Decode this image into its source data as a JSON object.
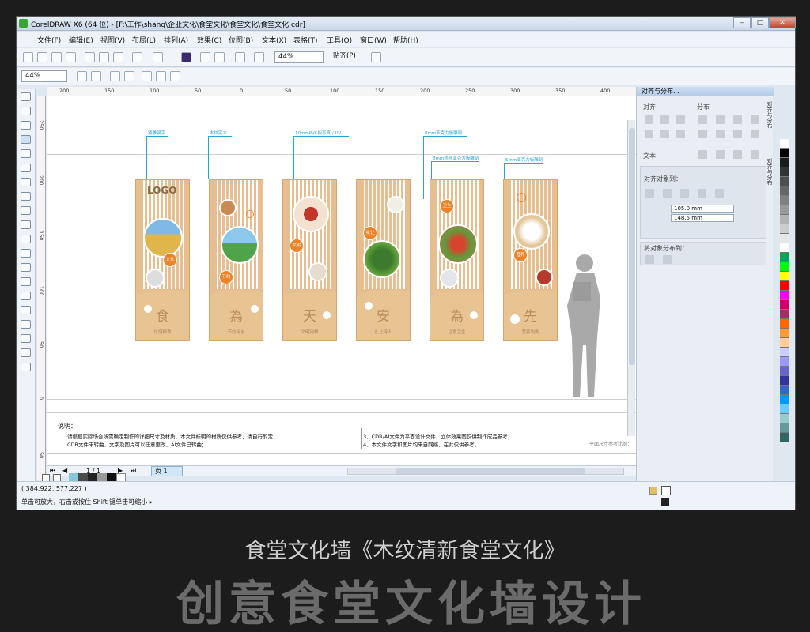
{
  "window": {
    "title": "CorelDRAW X6 (64 位) - [F:\\工作\\shang\\企业文化\\食堂文化\\食堂文化\\食堂文化.cdr]",
    "btn_min": "–",
    "btn_max": "□",
    "btn_close": "✕"
  },
  "menu": [
    "文件(F)",
    "编辑(E)",
    "视图(V)",
    "布局(L)",
    "排列(A)",
    "效果(C)",
    "位图(B)",
    "文本(X)",
    "表格(T)",
    "工具(O)",
    "窗口(W)",
    "帮助(H)"
  ],
  "toolbar": {
    "zoom": "44%",
    "snap": "贴齐(P)"
  },
  "propbar": {
    "zoom": "44%"
  },
  "ruler": {
    "h": [
      "200",
      "150",
      "100",
      "50",
      "0",
      "50",
      "100",
      "150",
      "200",
      "250",
      "300",
      "350",
      "400",
      "450"
    ],
    "v": [
      "250",
      "200",
      "150",
      "100",
      "50",
      "0",
      "50"
    ]
  },
  "ruler_bottom_label": "500",
  "panels": [
    {
      "glyph": "食",
      "sub": "珍惜粮食",
      "logo": "LOGO",
      "badge": "文化"
    },
    {
      "glyph": "為",
      "sub": "节约用水",
      "badge": "节约"
    },
    {
      "glyph": "天",
      "sub": "文明用餐",
      "badge": "文明"
    },
    {
      "glyph": "安",
      "sub": "礼让待人",
      "badge": "礼让"
    },
    {
      "glyph": "為",
      "sub": "注意卫生",
      "badge": "卫生"
    },
    {
      "glyph": "先",
      "sub": "营养均衡",
      "badge": "营养"
    }
  ],
  "annotations": {
    "a1": "镂雕钢字",
    "a2": "木纹实木",
    "a3": "10mmPVC板写真 / UV",
    "a4": "8mm亚克力板雕刻",
    "a5": "8mm热弯亚克力板雕刻",
    "a6": "5mm亚克力板雕刻"
  },
  "notes": {
    "title": "说明：",
    "l1": "请根据实际场合所需确定制作的详细尺寸及材质，本文件标明的材质仅供参考，请自行酌定；",
    "l2": "CDR文件未转曲，文字及图片可以任意更改，AI文件已转曲；",
    "r1": "3、CDR/AI文件为平面设计文件，立体效果图仅供制作成品参考；",
    "r2": "4、本文件文字和图片均来自网络，在此仅供参考。",
    "scale": "平面尺寸参考比例："
  },
  "page_nav": {
    "page": "1 / 1",
    "tab": "页 1"
  },
  "dock": {
    "title": "对齐与分布...",
    "align": "对齐",
    "distribute": "分布",
    "text": "文本",
    "align_to": "对齐对象到：",
    "x": "105.0 mm",
    "y": "148.5 mm",
    "distribute_to": "将对象分布到：",
    "tab1": "对齐与分布",
    "tab2": "对齐与分布"
  },
  "status": {
    "coords": "( 384.922, 577.227 )",
    "hint": "单击可放大，右击或按住 Shift 键单击可缩小 ▸"
  },
  "palette": [
    "#ffffff",
    "#000000",
    "#1a1a1a",
    "#333333",
    "#4d4d4d",
    "#666666",
    "#808080",
    "#999999",
    "#b3b3b3",
    "#cccccc",
    "#e6e6e6",
    "#ffffff",
    "#00a651",
    "#00ff00",
    "#ffff00",
    "#ff0000",
    "#ff00ff",
    "#cc0066",
    "#993366",
    "#ff6600",
    "#ff9933",
    "#ffcc99",
    "#ccccff",
    "#9999ff",
    "#6666cc",
    "#333399",
    "#3366cc",
    "#0099ff",
    "#66ccff",
    "#99cccc",
    "#669999",
    "#336666"
  ],
  "banner": {
    "line1": "食堂文化墙《木纹清新食堂文化》",
    "line2": "创意食堂文化墙设计"
  }
}
